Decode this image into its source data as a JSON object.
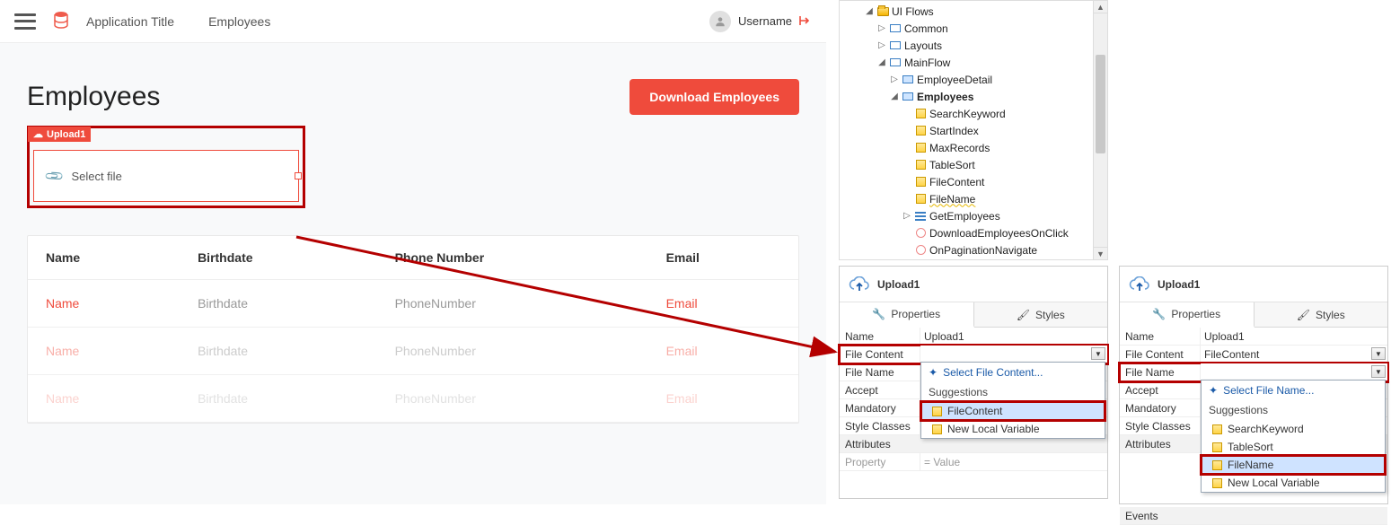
{
  "app": {
    "title": "Application Title",
    "nav_employees": "Employees",
    "username": "Username",
    "page_title": "Employees",
    "download_btn": "Download Employees",
    "upload_widget_tag": "Upload1",
    "upload_placeholder": "Select file",
    "table": {
      "headers": [
        "Name",
        "Birthdate",
        "Phone Number",
        "Email"
      ],
      "rows": [
        {
          "name": "Name",
          "birth": "Birthdate",
          "phone": "PhoneNumber",
          "email": "Email"
        },
        {
          "name": "Name",
          "birth": "Birthdate",
          "phone": "PhoneNumber",
          "email": "Email"
        },
        {
          "name": "Name",
          "birth": "Birthdate",
          "phone": "PhoneNumber",
          "email": "Email"
        }
      ]
    }
  },
  "tree": {
    "items": [
      {
        "indent": 2,
        "toggle": "▲",
        "icon": "folder",
        "label": "UI Flows"
      },
      {
        "indent": 3,
        "toggle": "▷",
        "icon": "screen",
        "label": "Common"
      },
      {
        "indent": 3,
        "toggle": "▷",
        "icon": "screen",
        "label": "Layouts"
      },
      {
        "indent": 3,
        "toggle": "▲",
        "icon": "screen",
        "label": "MainFlow"
      },
      {
        "indent": 4,
        "toggle": "▷",
        "icon": "screen-blue",
        "label": "EmployeeDetail"
      },
      {
        "indent": 4,
        "toggle": "▲",
        "icon": "screen-blue",
        "label": "Employees",
        "bold": true
      },
      {
        "indent": 5,
        "toggle": "",
        "icon": "sq",
        "label": "SearchKeyword"
      },
      {
        "indent": 5,
        "toggle": "",
        "icon": "sq",
        "label": "StartIndex"
      },
      {
        "indent": 5,
        "toggle": "",
        "icon": "sq",
        "label": "MaxRecords"
      },
      {
        "indent": 5,
        "toggle": "",
        "icon": "sq",
        "label": "TableSort"
      },
      {
        "indent": 5,
        "toggle": "",
        "icon": "sq",
        "label": "FileContent"
      },
      {
        "indent": 5,
        "toggle": "",
        "icon": "sq",
        "label": "FileName",
        "wavy": true
      },
      {
        "indent": 5,
        "toggle": "▷",
        "icon": "list",
        "label": "GetEmployees"
      },
      {
        "indent": 5,
        "toggle": "",
        "icon": "circle",
        "label": "DownloadEmployeesOnClick"
      },
      {
        "indent": 5,
        "toggle": "",
        "icon": "circle",
        "label": "OnPaginationNavigate"
      }
    ]
  },
  "panel1": {
    "title": "Upload1",
    "tab_props": "Properties",
    "tab_styles": "Styles",
    "rows": {
      "name_k": "Name",
      "name_v": "Upload1",
      "fc_k": "File Content",
      "fn_k": "File Name",
      "accept_k": "Accept",
      "mand_k": "Mandatory",
      "sc_k": "Style Classes",
      "attr_k": "Attributes",
      "prop_k": "Property",
      "val_k": "Value"
    },
    "dropdown": {
      "head": "Select File Content...",
      "section": "Suggestions",
      "items": [
        "FileContent",
        "New Local Variable"
      ]
    }
  },
  "panel2": {
    "title": "Upload1",
    "tab_props": "Properties",
    "tab_styles": "Styles",
    "rows": {
      "name_k": "Name",
      "name_v": "Upload1",
      "fc_k": "File Content",
      "fc_v": "FileContent",
      "fn_k": "File Name",
      "accept_k": "Accept",
      "mand_k": "Mandatory",
      "sc_k": "Style Classes",
      "attr_k": "Attributes",
      "events_k": "Events"
    },
    "dropdown": {
      "head": "Select File Name...",
      "section": "Suggestions",
      "items": [
        "SearchKeyword",
        "TableSort",
        "FileName",
        "New Local Variable"
      ]
    }
  },
  "equals": "="
}
